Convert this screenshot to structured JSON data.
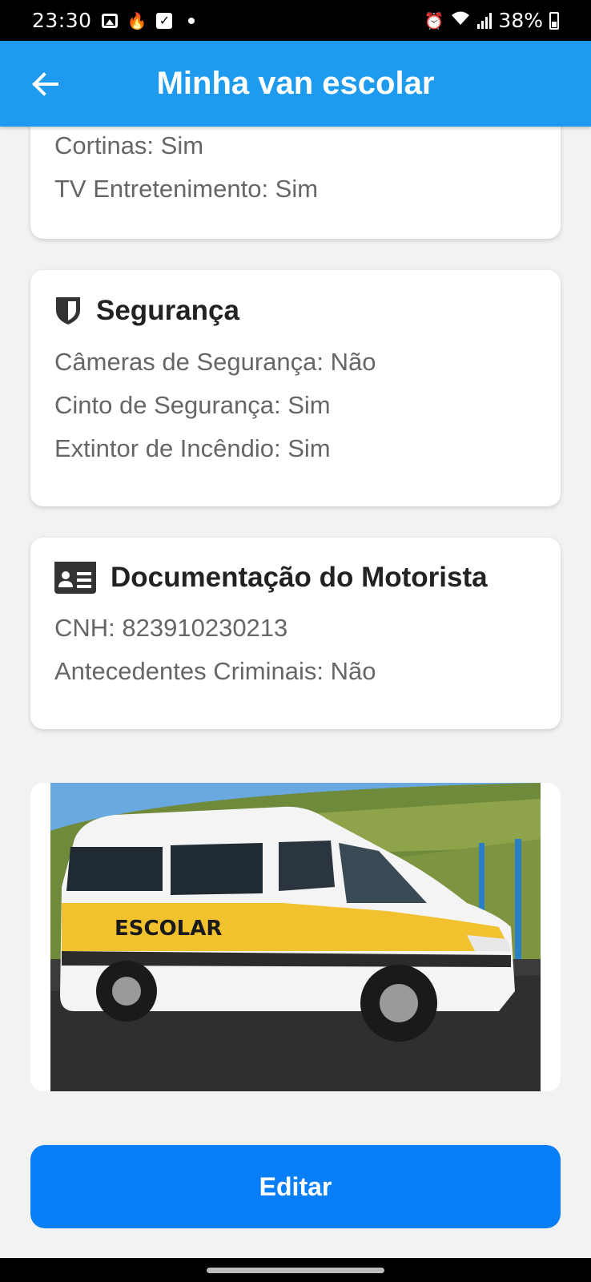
{
  "status_bar": {
    "time": "23:30",
    "battery": "38%"
  },
  "header": {
    "title": "Minha van escolar",
    "back_icon": "arrow-left-icon"
  },
  "comfort_card": {
    "lines": [
      "Cortinas: Sim",
      "TV Entretenimento: Sim"
    ]
  },
  "security_card": {
    "title": "Segurança",
    "icon": "shield-icon",
    "lines": [
      "Câmeras de Segurança: Não",
      "Cinto de Segurança: Sim",
      "Extintor de Incêndio: Sim"
    ]
  },
  "driver_docs_card": {
    "title": "Documentação do Motorista",
    "icon": "id-card-icon",
    "lines": [
      "CNH: 823910230213",
      "Antecedentes Criminais: Não"
    ]
  },
  "photo": {
    "van_label": "ESCOLAR"
  },
  "actions": {
    "edit_label": "Editar"
  },
  "colors": {
    "app_bar": "#1e9bef",
    "edit_button": "#087ff7",
    "background": "#f2f2f2"
  }
}
